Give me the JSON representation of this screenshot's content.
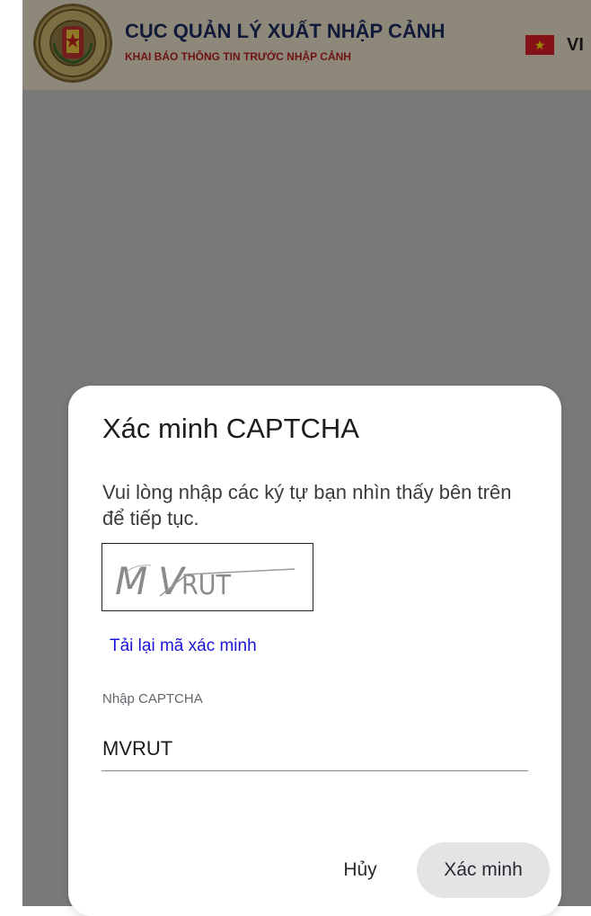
{
  "header": {
    "title": "CỤC QUẢN LÝ XUẤT NHẬP CẢNH",
    "subtitle": "KHAI BÁO THÔNG TIN TRƯỚC NHẬP CẢNH",
    "emblem_text_top": "QUẢN LÝ XUẤT NHẬP CẢNH",
    "emblem_text_bottom": "IMMIGRATION",
    "language": "VI",
    "flag_icon": "vietnam-flag-icon"
  },
  "dialog": {
    "title": "Xác minh CAPTCHA",
    "instruction": "Vui lòng nhập các ký tự bạn nhìn thấy bên trên để tiếp tục.",
    "captcha_text": "MVRUT",
    "reload_link": "Tải lại mã xác minh",
    "input_label": "Nhập CAPTCHA",
    "input_value": "MVRUT",
    "cancel_label": "Hủy",
    "verify_label": "Xác minh"
  },
  "colors": {
    "overlay": "#7a7a7a",
    "link": "#1a14d6",
    "title_navy": "#1c2a5a",
    "subtitle_red": "#b21f1f"
  }
}
